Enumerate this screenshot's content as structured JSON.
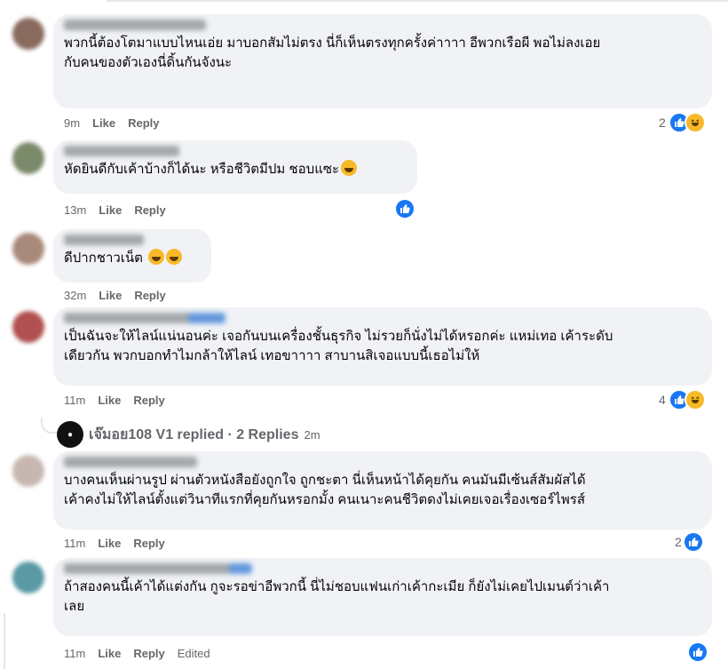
{
  "colors": {
    "bubble": "#f0f2f5",
    "meta": "#65676b",
    "like_blue": "#1877f2",
    "haha_yellow": "#f7b928"
  },
  "comments": [
    {
      "text": "พวกนี้ต้องโตมาแบบไหนเอ่ย มาบอกสัมไม่ตรง นี่ก็เห็นตรงทุกครั้งค่าาาา อีพวกเรือผี พอไม่ลงเอย\nกับคนของตัวเองนี่ดิ้นกันจังนะ",
      "time": "9m",
      "like": "Like",
      "reply": "Reply",
      "reaction_count": "2",
      "reactions": [
        "like-icon",
        "haha-icon"
      ]
    },
    {
      "text": "หัดยินดีกับเค้าบ้างก็ได้นะ หรือชีวิตมีปม ชอบแซะ",
      "time": "13m",
      "like": "Like",
      "reply": "Reply",
      "reaction_count": "",
      "reactions": [
        "like-icon"
      ]
    },
    {
      "text": "ดีปากชาวเน็ต",
      "time": "32m",
      "like": "Like",
      "reply": "Reply",
      "reaction_count": "",
      "reactions": []
    },
    {
      "text": "เป็นฉันจะให้ไลน์แน่นอนค่ะ เจอกันบนเครื่องชั้นธุรกิจ ไม่รวยก็นั่งไม่ได้หรอกค่ะ แหม่เทอ เค้าระดับ\nเดียวกัน พวกบอกทำไมกล้าให้ไลน์ เทอขาาาา สาบานสิเจอแบบนี้เธอไม่ให้",
      "time": "11m",
      "like": "Like",
      "reply": "Reply",
      "reaction_count": "4",
      "reactions": [
        "like-icon",
        "haha-icon"
      ]
    },
    {
      "text": "บางคนเห็นผ่านรูป ผ่านตัวหนังสือยังถูกใจ ถูกชะตา นี่เห็นหน้าได้คุยกัน คนมันมีเซ้นส์สัมผัสได้\nเค้าคงไม่ให้ไลน์ตั้งแต่วินาทีแรกที่คุยกันหรอกมั้ง คนเนาะคนชีวิตดงไม่เคยเจอเรื่องเซอร์ไพรส์",
      "time": "11m",
      "like": "Like",
      "reply": "Reply",
      "reaction_count": "2",
      "reactions": [
        "like-icon"
      ]
    },
    {
      "text": "ถ้าสองคนนี้เค้าได้แต่งกัน กูจะรอข่าอีพวกนี้ นี่ไม่ชอบแฟนเก่าเค้ากะเมีย ก็ยังไม่เคยไปเมนต์ว่าเค้า\nเลย",
      "time": "11m",
      "like": "Like",
      "reply": "Reply",
      "edited": "Edited",
      "reaction_count": "",
      "reactions": [
        "like-icon"
      ]
    }
  ],
  "replies": {
    "summary": "เจ๊มอย108 V1 replied · 2 Replies",
    "time": "2m"
  }
}
